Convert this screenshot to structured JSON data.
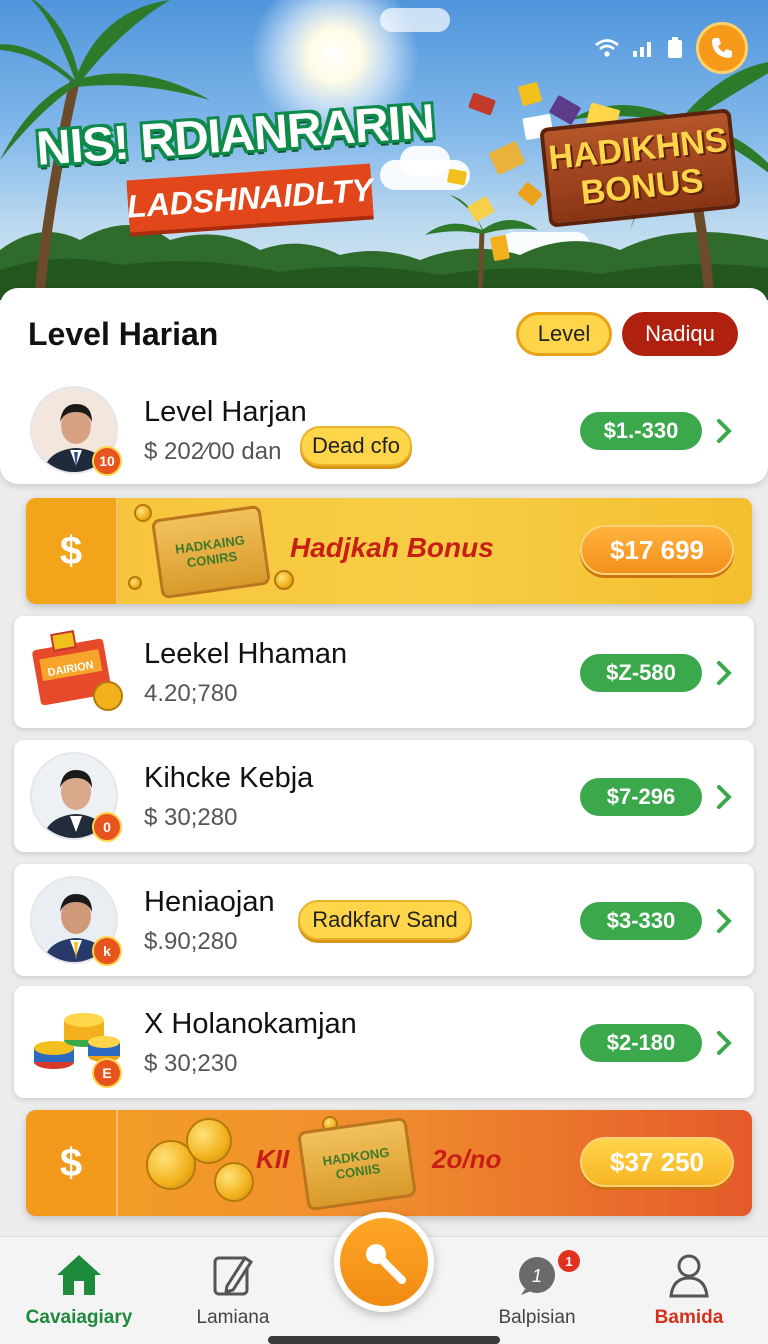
{
  "hero": {
    "title": "NIS! RDIANRARIN",
    "ribbon": "LADSHNAIDLTY",
    "bonus_sign_line1": "HADIKHNS",
    "bonus_sign_line2": "BONUS"
  },
  "status_icons": [
    "wifi-icon",
    "signal-icon",
    "battery-icon",
    "phone-call-icon"
  ],
  "section": {
    "title": "Level Harian",
    "pill_level": "Level",
    "pill_other": "Nadiqu"
  },
  "rows": [
    {
      "name": "Level Harjan",
      "sub": "$ 202⁄00 dan",
      "tag": "Dead cfo",
      "amount": "$1.-330",
      "badge": "10"
    },
    {
      "name": "Leekel Hhaman",
      "sub": "4.20;780",
      "amount": "$Z-580",
      "thumb_text": "DAIRION"
    },
    {
      "name": "Kihcke Kebja",
      "sub": "$ 30;280",
      "amount": "$7-296",
      "badge": "0"
    },
    {
      "name": "Heniaojan",
      "sub": "$.90;280",
      "tag": "Radkfarv Sand",
      "amount": "$3-330",
      "badge": "k"
    },
    {
      "name": "X Holanokamjan",
      "sub": "$ 30;230",
      "amount": "$2-180",
      "badge": "E"
    }
  ],
  "banners": [
    {
      "dollar": "$",
      "bag_text": "HADKAING CONIRS",
      "text": "Hadjkah Bonus",
      "button": "$17 699"
    },
    {
      "dollar": "$",
      "bag_text": "HADKONG CONIIS",
      "text_left": "KII",
      "text_right": "2o/no",
      "button": "$37 250"
    }
  ],
  "nav": {
    "items": [
      {
        "label": "Cavaiagiary",
        "icon": "home-icon"
      },
      {
        "label": "Lamiana",
        "icon": "edit-icon"
      },
      {
        "label": "Balpisian",
        "icon": "chat-icon",
        "badge": "1"
      },
      {
        "label": "Bamida",
        "icon": "profile-icon"
      }
    ],
    "center_icon": "microphone-icon"
  },
  "colors": {
    "accent_green": "#3aa84b",
    "accent_orange": "#f79a1a",
    "accent_red": "#b0200f",
    "accent_yellow": "#ffd54a"
  }
}
